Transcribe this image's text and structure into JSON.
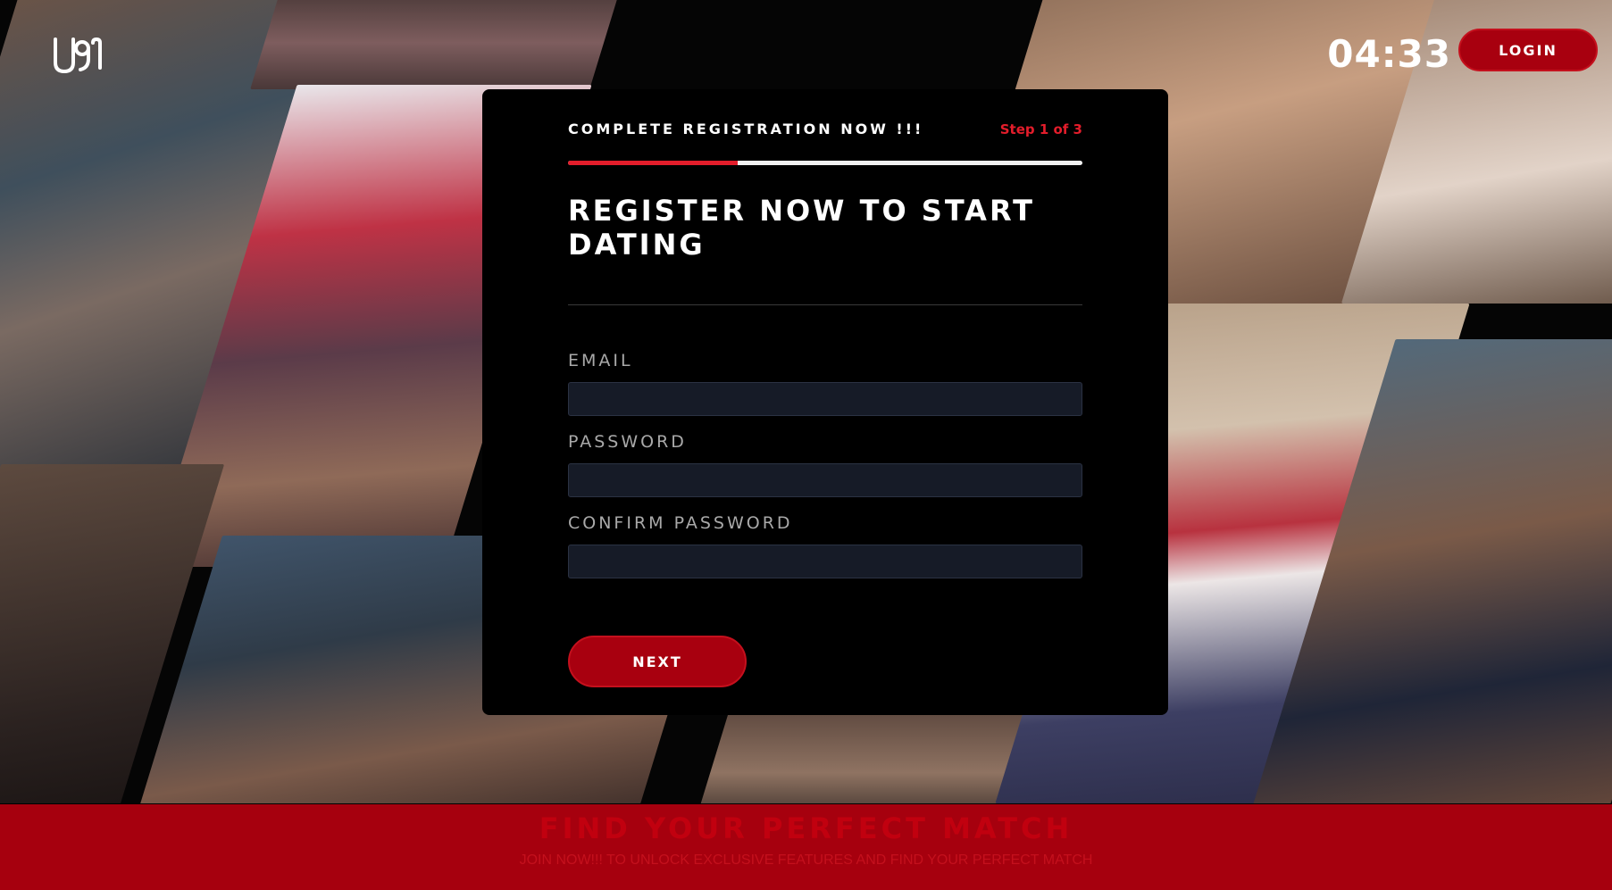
{
  "header": {
    "timer": "04:33",
    "login_label": "LOGIN"
  },
  "form": {
    "banner": "COMPLETE REGISTRATION NOW !!!",
    "step": "Step 1 of 3",
    "progress": 0.33,
    "heading": "REGISTER NOW TO START DATING",
    "fields": [
      {
        "label": "EMAIL",
        "value": "",
        "placeholder": ""
      },
      {
        "label": "PASSWORD",
        "value": "",
        "placeholder": ""
      },
      {
        "label": "CONFIRM PASSWORD",
        "value": "",
        "placeholder": ""
      }
    ],
    "next_label": "NEXT"
  },
  "footer": {
    "title": "FIND YOUR PERFECT MATCH",
    "subtitle": "JOIN NOW!!! TO UNLOCK EXCLUSIVE FEATURES AND FIND YOUR PERFECT MATCH"
  },
  "colors": {
    "accent": "#a8000f",
    "accent_text": "#e31d2b",
    "footer_bg": "#a6000e",
    "input_bg": "#161b27"
  }
}
